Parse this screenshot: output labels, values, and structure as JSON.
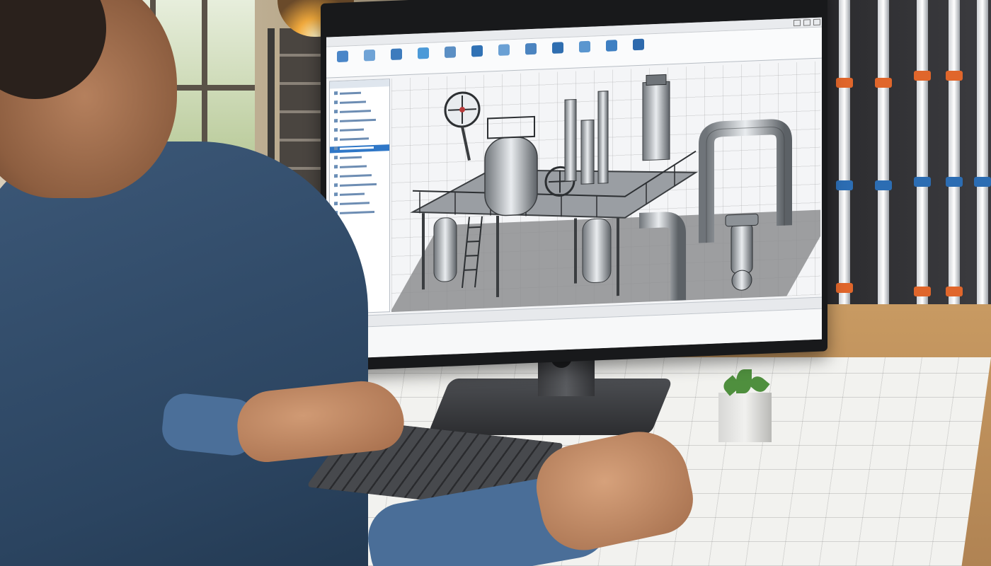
{
  "scene": {
    "description_alt": "",
    "colors": {
      "shirt": "#2f4b6b",
      "desk": "#c29360",
      "screen_accent": "#2f77c7",
      "pipe_band_orange": "#e0662b",
      "pipe_band_blue": "#2c6db3"
    }
  },
  "cad_app": {
    "ribbon_buttons": [
      {
        "icon": "save-icon",
        "color": "#4a86c8"
      },
      {
        "icon": "open-icon",
        "color": "#6fa3d6"
      },
      {
        "icon": "draw-icon",
        "color": "#3d7bbd"
      },
      {
        "icon": "modify-icon",
        "color": "#4c9ad8"
      },
      {
        "icon": "pipe-icon",
        "color": "#5b8fc4"
      },
      {
        "icon": "valve-icon",
        "color": "#3172b5"
      },
      {
        "icon": "layer-icon",
        "color": "#6aa0d4"
      },
      {
        "icon": "measure-icon",
        "color": "#4b84c0"
      },
      {
        "icon": "render-icon",
        "color": "#2f6eb0"
      },
      {
        "icon": "view-icon",
        "color": "#5a96cf"
      },
      {
        "icon": "annotate-icon",
        "color": "#3e7fc2"
      },
      {
        "icon": "export-icon",
        "color": "#2e6aad"
      }
    ],
    "tree_items": [
      {
        "icon": "folder-icon"
      },
      {
        "icon": "folder-icon"
      },
      {
        "icon": "part-icon"
      },
      {
        "icon": "part-icon"
      },
      {
        "icon": "part-icon"
      },
      {
        "icon": "part-icon"
      },
      {
        "icon": "part-icon",
        "selected": true
      },
      {
        "icon": "part-icon"
      },
      {
        "icon": "part-icon"
      },
      {
        "icon": "part-icon"
      },
      {
        "icon": "part-icon"
      },
      {
        "icon": "part-icon"
      },
      {
        "icon": "part-icon"
      },
      {
        "icon": "part-icon"
      }
    ]
  }
}
